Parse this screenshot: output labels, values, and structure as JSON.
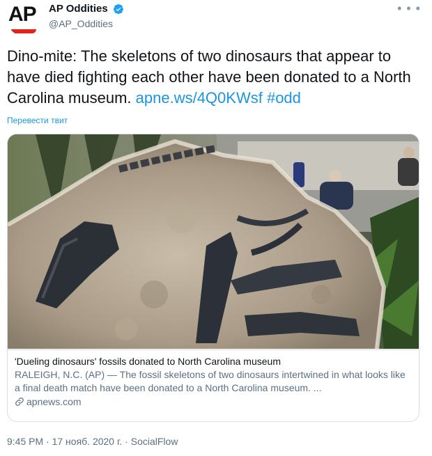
{
  "author": {
    "display_name": "AP Oddities",
    "handle": "@AP_Oddities",
    "avatar_text": "AP"
  },
  "tweet": {
    "text": "Dino-mite: The skeletons of two dinosaurs that appear to have died fighting each other have been donated to a North Carolina museum. ",
    "link": "apne.ws/4Q0KWsf",
    "hashtag": "#odd",
    "translate_label": "Перевести твит"
  },
  "card": {
    "title": "'Dueling dinosaurs' fossils donated to North Carolina museum",
    "description": "RALEIGH, N.C. (AP) — The fossil skeletons of two dinosaurs intertwined in what looks like a final death match have been donated to a North Carolina museum. ...",
    "domain": "apnews.com"
  },
  "meta": {
    "time": "9:45 PM",
    "date": "17 нояб. 2020 г.",
    "source": "SocialFlow",
    "separator": " · "
  },
  "colors": {
    "link": "#1b95e0",
    "secondary_text": "#5b7083",
    "verified": "#1da1f2",
    "ap_red": "#e2231a"
  },
  "icons": [
    "verified-badge-icon",
    "more-icon",
    "link-icon"
  ]
}
